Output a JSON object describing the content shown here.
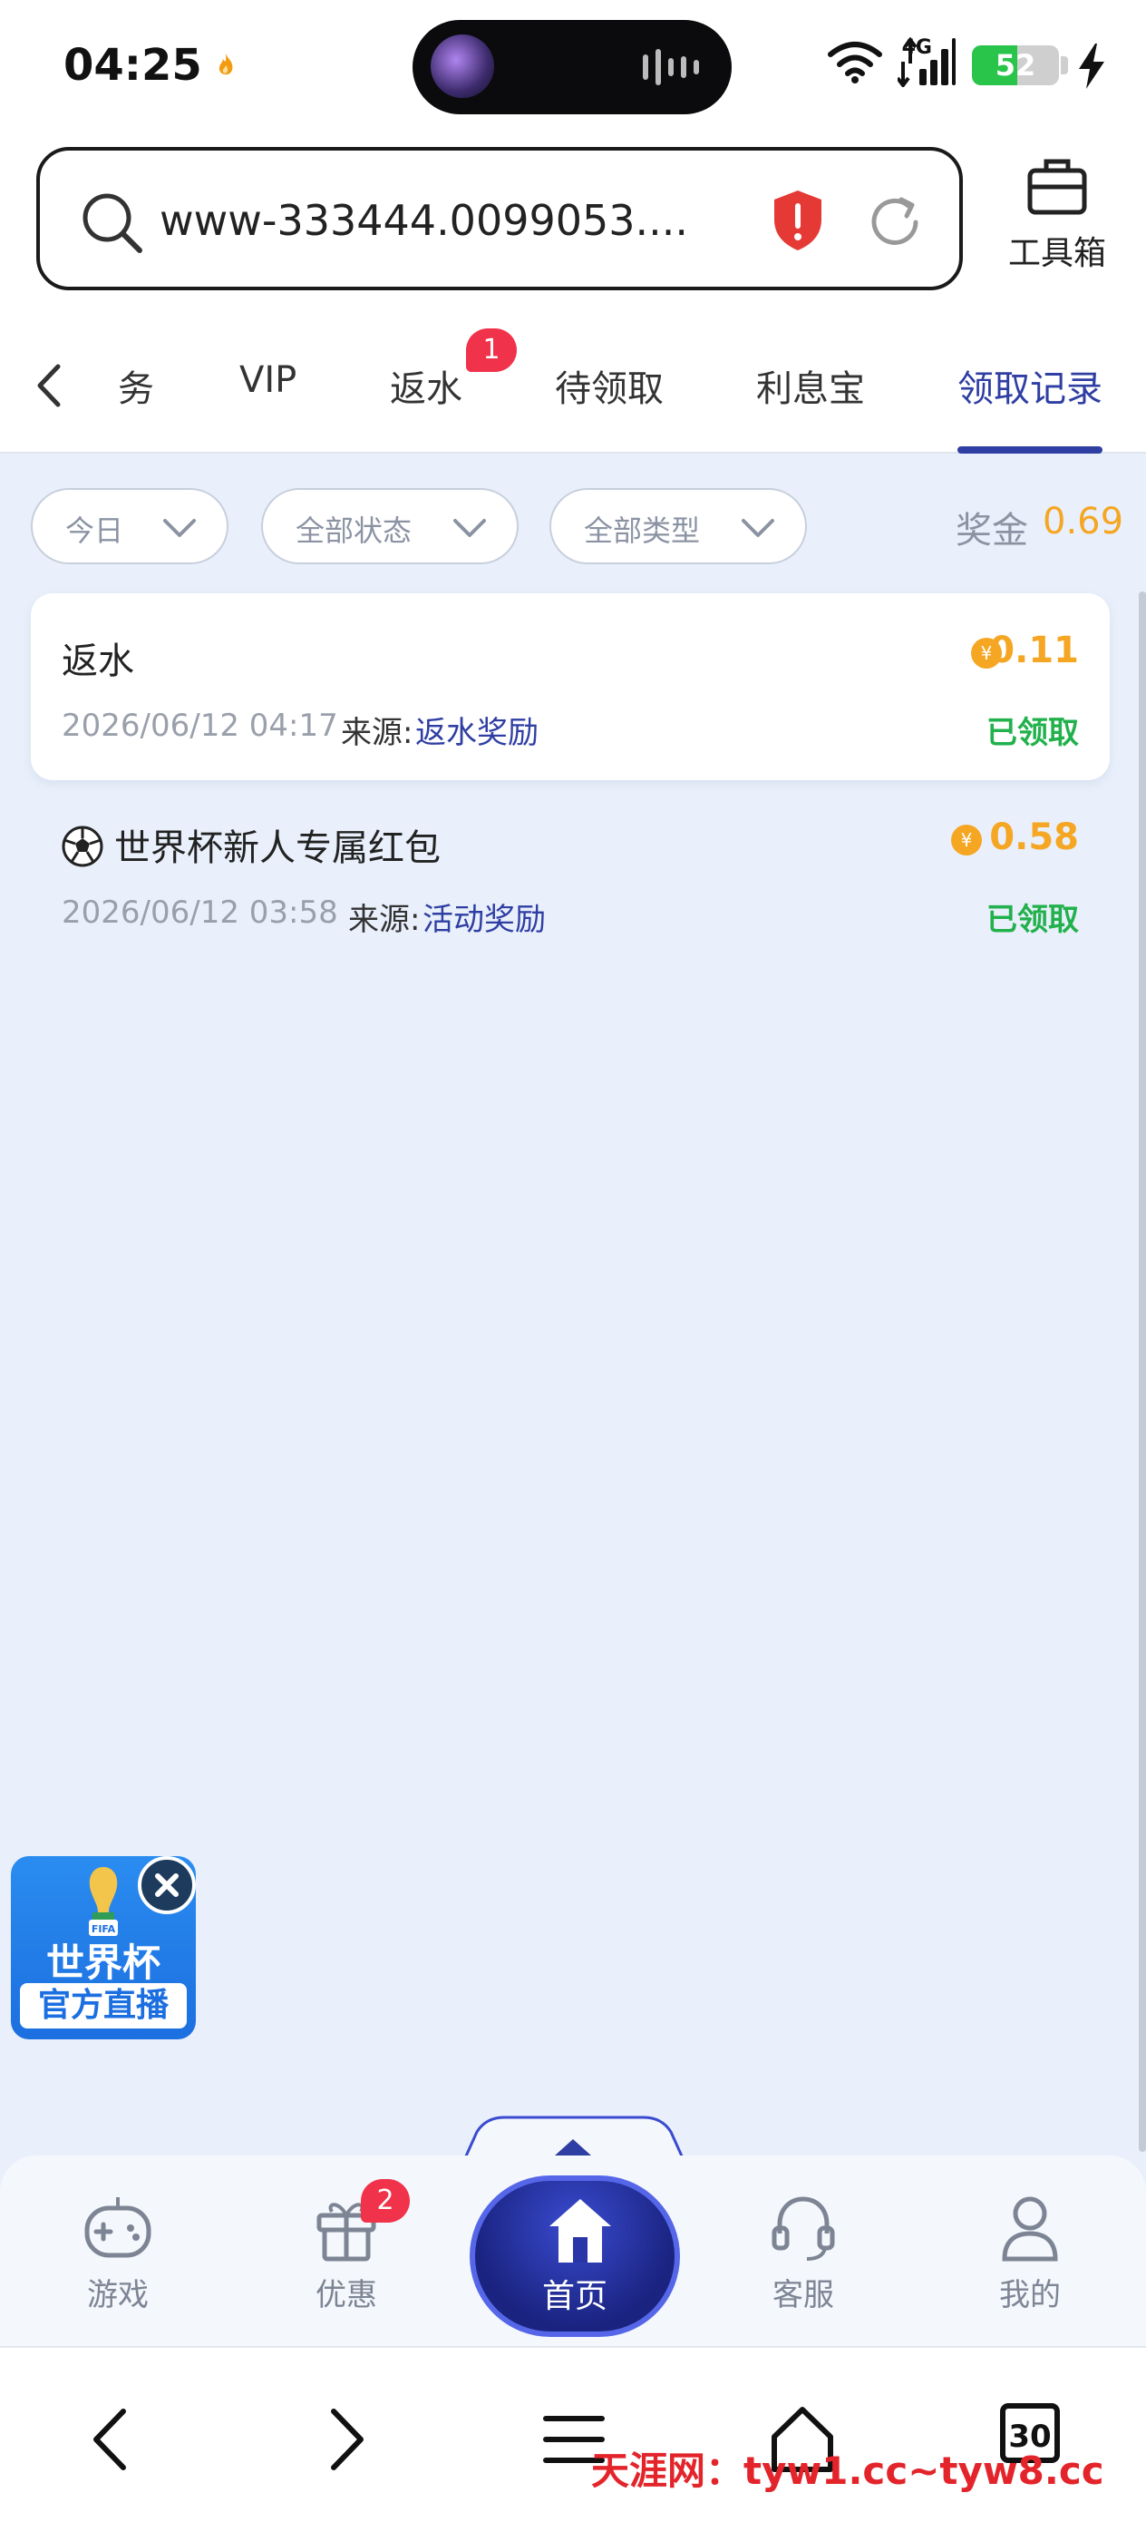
{
  "status_bar": {
    "time": "04:25",
    "network": "4G",
    "battery": "52",
    "battery_level": 0.52,
    "colors": {
      "battery": "#29c44a"
    }
  },
  "browser": {
    "url": "www-333444.0099053....",
    "toolbox_label": "工具箱"
  },
  "tabs": {
    "items": [
      {
        "label": "务"
      },
      {
        "label": "VIP"
      },
      {
        "label": "返水",
        "badge": "1"
      },
      {
        "label": "待领取"
      },
      {
        "label": "利息宝"
      },
      {
        "label": "领取记录",
        "active": true
      }
    ]
  },
  "filters": {
    "date": "今日",
    "status": "全部状态",
    "type": "全部类型",
    "bonus_label": "奖金",
    "bonus_value": "0.69"
  },
  "records": [
    {
      "title": "返水",
      "datetime": "2026/06/12 04:17",
      "source_label": "来源:",
      "source": "返水奖励",
      "amount": "0.11",
      "status": "已领取"
    },
    {
      "title": "世界杯新人专属红包",
      "datetime": "2026/06/12 03:58",
      "source_label": "来源:",
      "source": "活动奖励",
      "amount": "0.58",
      "status": "已领取"
    }
  ],
  "ad": {
    "title": "世界杯",
    "subtitle": "官方直播",
    "close": "×"
  },
  "app_nav": {
    "games": "游戏",
    "promotions": "优惠",
    "promotions_badge": "2",
    "home": "首页",
    "support": "客服",
    "mine": "我的"
  },
  "system_nav": {
    "tabs_count": "30"
  },
  "watermark": "天涯网：tyw1.cc~tyw8.cc",
  "colors": {
    "accent": "#2f3ea3",
    "amount": "#f5a623",
    "claimed": "#22b14c",
    "badge": "#f0324a",
    "background": "#e9f0fb"
  }
}
